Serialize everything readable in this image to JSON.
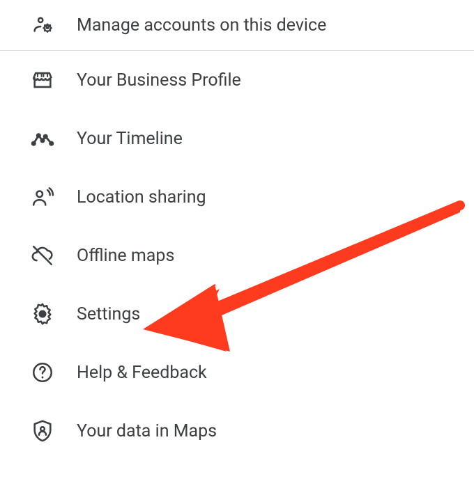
{
  "menu": {
    "manage_accounts": "Manage accounts on this device",
    "business_profile": "Your Business Profile",
    "timeline": "Your Timeline",
    "location_sharing": "Location sharing",
    "offline_maps": "Offline maps",
    "settings": "Settings",
    "help_feedback": "Help & Feedback",
    "your_data": "Your data in Maps"
  },
  "annotation": {
    "arrow_color": "#ff3b1f",
    "target": "settings"
  }
}
